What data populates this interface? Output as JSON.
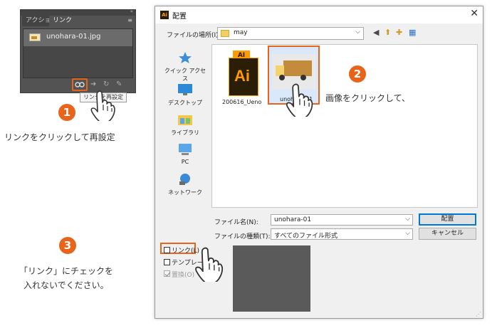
{
  "links_panel": {
    "tabs": [
      "アクション",
      "リンク"
    ],
    "collapse_glyph": "«",
    "menu_glyph": "≡",
    "file_name": "unohara-01.jpg",
    "tooltip": "リンクを再設定"
  },
  "steps": {
    "one": {
      "number": "1",
      "caption": "リンクをクリックして再設定"
    },
    "two": {
      "number": "2",
      "caption": "画像をクリックして、"
    },
    "three": {
      "number": "3",
      "caption_line1": "「リンク」にチェックを",
      "caption_line2": "入れないでください。"
    }
  },
  "dialog": {
    "app_badge": "Ai",
    "title": "配置",
    "close": "✕",
    "location_label": "ファイルの場所(I):",
    "location_value": "may",
    "places": [
      "クイック アクセス",
      "デスクトップ",
      "ライブラリ",
      "PC",
      "ネットワーク"
    ],
    "files": [
      {
        "name": "200616_Ueno",
        "type_tag": "AI",
        "icon_text": "Ai"
      },
      {
        "name": "unohara-01",
        "selected": true
      }
    ],
    "file_name_label": "ファイル名(N):",
    "file_name_value": "unohara-01",
    "file_type_label": "ファイルの種類(T):",
    "file_type_value": "すべてのファイル形式",
    "place_button": "配置",
    "cancel_button": "キャンセル",
    "options": [
      {
        "label": "リンク(L)",
        "checked": false,
        "disabled": false
      },
      {
        "label": "テンプレート",
        "checked": false,
        "disabled": false
      },
      {
        "label": "置換(O)",
        "checked": true,
        "disabled": true
      }
    ]
  },
  "colors": {
    "accent": "#e8641b",
    "ai_dark": "#2b1e06",
    "ai_orange": "#ff9a00",
    "button_focus": "#0078d7"
  }
}
